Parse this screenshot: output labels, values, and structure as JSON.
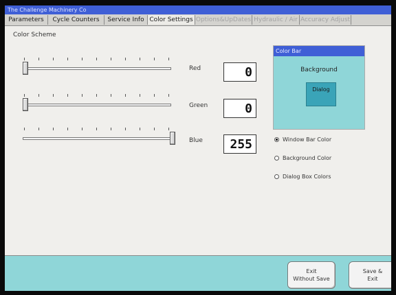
{
  "window": {
    "title": "The Challenge Machinery Co"
  },
  "tabs": [
    {
      "label": "Parameters",
      "state": "normal"
    },
    {
      "label": "Cycle Counters",
      "state": "normal"
    },
    {
      "label": "Service Info",
      "state": "normal"
    },
    {
      "label": "Color Settings",
      "state": "active"
    },
    {
      "label": "Options&UpDates",
      "state": "disabled"
    },
    {
      "label": "Hydraulic / Air",
      "state": "disabled"
    },
    {
      "label": "Accuracy Adjust",
      "state": "disabled"
    }
  ],
  "section_label": "Color Scheme",
  "channels": [
    {
      "label": "Red",
      "value": "0",
      "level": 0
    },
    {
      "label": "Green",
      "value": "0",
      "level": 0
    },
    {
      "label": "Blue",
      "value": "255",
      "level": 1
    }
  ],
  "color_bar": {
    "header": "Color Bar",
    "background_label": "Background",
    "dialog_label": "Dialog"
  },
  "radio_options": [
    {
      "label": "Window Bar Color",
      "checked": true
    },
    {
      "label": "Background Color",
      "checked": false
    },
    {
      "label": "Dialog Box Colors",
      "checked": false
    }
  ],
  "buttons": {
    "exit_without_save": "Exit\nWithout Save",
    "save_and_exit": "Save &\nExit"
  },
  "colors": {
    "title_bar": "#3f5fd6",
    "background": "#8fd6d8",
    "dialog": "#3aa4b8"
  }
}
